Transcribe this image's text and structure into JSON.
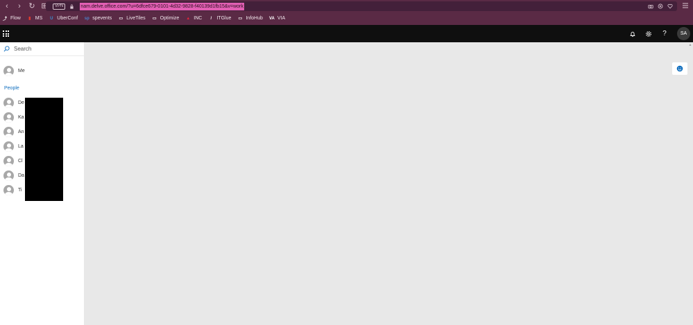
{
  "browser": {
    "vpn_label": "VPN",
    "url": "nam.delve.office.com/?u=6dfce679-0101-4d32-9828-f40139d1fb15&v=work",
    "back_glyph": "‹",
    "forward_glyph": "›",
    "reload_glyph": "↻",
    "tabs_glyph": "⊞"
  },
  "bookmarks": [
    {
      "label": "Flow",
      "icon": "flow-icon",
      "glyph": "⤴",
      "color": "#ffffff"
    },
    {
      "label": "MS",
      "icon": "ms-icon",
      "glyph": "▮",
      "color": "#e03b2e"
    },
    {
      "label": "UberConf",
      "icon": "uberconf-icon",
      "glyph": "U",
      "color": "#3b8fd0"
    },
    {
      "label": "spevents",
      "icon": "spevents-icon",
      "glyph": "sp",
      "color": "#4a7fc8"
    },
    {
      "label": "LiveTiles",
      "icon": "folder-icon",
      "glyph": "▭",
      "color": "#ffffff"
    },
    {
      "label": "Optimize",
      "icon": "folder-icon",
      "glyph": "▭",
      "color": "#ffffff"
    },
    {
      "label": "INC",
      "icon": "inc-icon",
      "glyph": "▲",
      "color": "#e0243a"
    },
    {
      "label": "ITGlue",
      "icon": "itglue-icon",
      "glyph": "/",
      "color": "#ffffff"
    },
    {
      "label": "InfoHub",
      "icon": "folder-icon",
      "glyph": "▭",
      "color": "#ffffff"
    },
    {
      "label": "VIA",
      "icon": "via-icon",
      "glyph": "VA",
      "color": "#ffffff"
    }
  ],
  "appbar": {
    "help_glyph": "?",
    "user_initials": "SA"
  },
  "leftpane": {
    "search_placeholder": "Search",
    "me_label": "Me",
    "people_heading": "People",
    "people": [
      "De",
      "Ka",
      "An",
      "La",
      "Cl",
      "Da",
      "Ti"
    ]
  },
  "colors": {
    "chrome": "#5a2a45",
    "url_highlight": "#e25fb3",
    "appbar": "#0f0f0f",
    "accent": "#106ebe",
    "content_bg": "#e8e8e8"
  }
}
